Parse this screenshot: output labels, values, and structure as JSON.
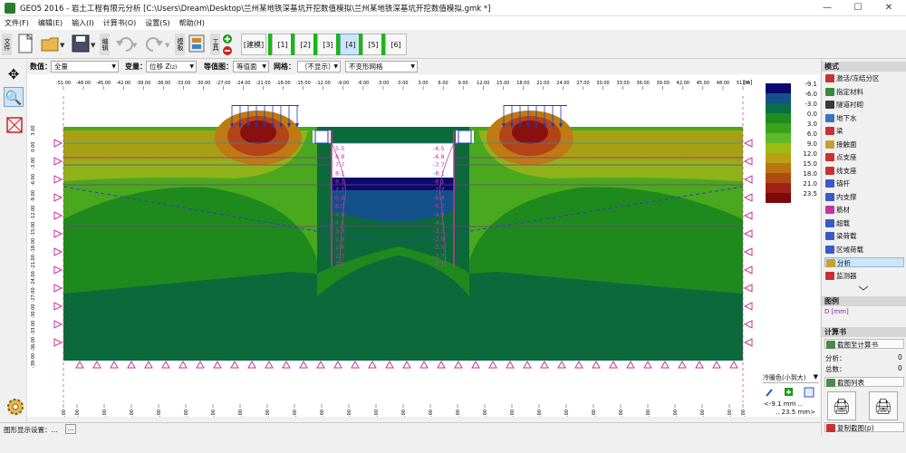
{
  "titlebar": {
    "title": "GEO5 2016 - 岩土工程有限元分析 [C:\\Users\\Dream\\Desktop\\兰州某地铁深基坑开挖数值模拟\\兰州某地铁深基坑开挖数值模拟.gmk *]",
    "min": "—",
    "max": "☐",
    "close": "✕"
  },
  "menu": [
    "文件(F)",
    "编辑(E)",
    "输入(I)",
    "计算书(O)",
    "设置(S)",
    "帮助(H)"
  ],
  "toolbar": {
    "file_label": "文件",
    "edit_label": "编辑",
    "mode_label": "模板",
    "tools_label": "工具",
    "model_label": "[建模]",
    "stages": [
      "[1]",
      "[2]",
      "[3]",
      "[4]",
      "[5]",
      "[6]"
    ],
    "active_stage": 3
  },
  "params": {
    "value_label": "数值：",
    "value_sel": "全量",
    "var_label": "变量：",
    "var_sel": "位移 Z",
    "var_sub": "(z)",
    "contour_label": "等值图：",
    "contour_sel": "等值面",
    "mesh_label": "网格：",
    "mesh_sel": "（不显示）",
    "deform_sel": "不变形网格"
  },
  "canvas": {
    "unit": "[m]",
    "top_ticks": [
      "-51.00",
      "-48.00",
      "-45.00",
      "-42.00",
      "-39.00",
      "-36.00",
      "-33.00",
      "-30.00",
      "-27.00",
      "-24.00",
      "-21.00",
      "-18.00",
      "-15.00",
      "-12.00",
      "-9.00",
      "-6.00",
      "-3.00",
      "0.00",
      "3.00",
      "6.00",
      "9.00",
      "12.00",
      "15.00",
      "18.00",
      "21.00",
      "24.00",
      "27.00",
      "30.00",
      "33.00",
      "36.00",
      "39.00",
      "42.00",
      "45.00",
      "48.00",
      "51.00"
    ],
    "bottom_ticks": [
      "-50.00",
      "-48.00",
      "-44.00",
      "-40.00",
      "-36.00",
      "-32.00",
      "-28.00",
      "-24.00",
      "-20.00",
      "-16.00",
      "-12.00",
      "-8.00",
      "-4.00",
      "0.00",
      "4.00",
      "8.00",
      "12.00",
      "16.00",
      "20.00",
      "24.00",
      "28.00",
      "32.00",
      "36.00",
      "40.00",
      "44.00",
      "48.00",
      "50.00"
    ],
    "left_ticks": [
      "3.00",
      "0.00",
      "-3.00",
      "-6.00",
      "-9.00",
      "-12.00",
      "-15.00",
      "-18.00",
      "-21.00",
      "-24.00",
      "-27.00",
      "-30.00",
      "-33.00",
      "-36.00",
      "-39.00"
    ],
    "left_wall_labels": [
      "5.5",
      "6.8",
      "7.7",
      "8.1",
      "8.1",
      "7.7",
      "6.8",
      "6.0",
      "4.9",
      "4.2",
      "3.3",
      "2.9",
      "2.6",
      "2.3",
      "2.1"
    ],
    "right_wall_labels": [
      "-6.5",
      "-6.8",
      "-7.7",
      "-8.1",
      "-8.1",
      "-7.7",
      "-6.8",
      "-6.0",
      "-4.9",
      "-4.2",
      "-3.3",
      "-2.9",
      "-2.5",
      "-2.3",
      "-2.1"
    ]
  },
  "legend": {
    "values": [
      "-9.1",
      "-6.0",
      "-3.0",
      "0.0",
      "3.0",
      "6.0",
      "9.0",
      "12.0",
      "15.0",
      "18.0",
      "21.0",
      "23.5"
    ],
    "colors": [
      "#0a0a6e",
      "#14508a",
      "#0a6e46",
      "#1f8c1f",
      "#3aa31c",
      "#5fb82a",
      "#9cbc14",
      "#b8a012",
      "#b87512",
      "#b04a14",
      "#a0201a",
      "#7c0a0a"
    ],
    "scheme": "冷暖色(小到大)",
    "min_text": "<-9.1 mm ..",
    "max_text": ".. 23.5 mm>"
  },
  "rightpanel": {
    "mode_head": "模式",
    "items": [
      {
        "label": "激活/冻结分区",
        "color": "#c83232"
      },
      {
        "label": "指定材料",
        "color": "#3a8a3a"
      },
      {
        "label": "隧道衬砌",
        "color": "#3a3a3a"
      },
      {
        "label": "地下水",
        "color": "#3a70c8"
      },
      {
        "label": "梁",
        "color": "#c83232"
      },
      {
        "label": "接触面",
        "color": "#c8a032"
      },
      {
        "label": "点支座",
        "color": "#c83232"
      },
      {
        "label": "线支座",
        "color": "#c83232"
      },
      {
        "label": "锚杆",
        "color": "#3a5ac8"
      },
      {
        "label": "内支撑",
        "color": "#3a5ac8"
      },
      {
        "label": "筋材",
        "color": "#c832a0"
      },
      {
        "label": "超载",
        "color": "#3a5ac8"
      },
      {
        "label": "梁荷载",
        "color": "#3a5ac8"
      },
      {
        "label": "区域荷载",
        "color": "#3a5ac8"
      },
      {
        "label": "分析",
        "color": "#c8a032"
      },
      {
        "label": "监测器",
        "color": "#c83232"
      }
    ],
    "active_item": 14,
    "legend_head": "图例",
    "legend_unit": "D [mm]",
    "report_head": "计算书",
    "to_report": "截图至计算书",
    "analysis_label": "分析：",
    "analysis_val": "0",
    "total_label": "总数：",
    "total_val": "0",
    "shot_list": "截图列表",
    "copy_view": "复制截图(p)"
  },
  "status": {
    "text": "图形显示设置：...",
    "dots": "..."
  }
}
